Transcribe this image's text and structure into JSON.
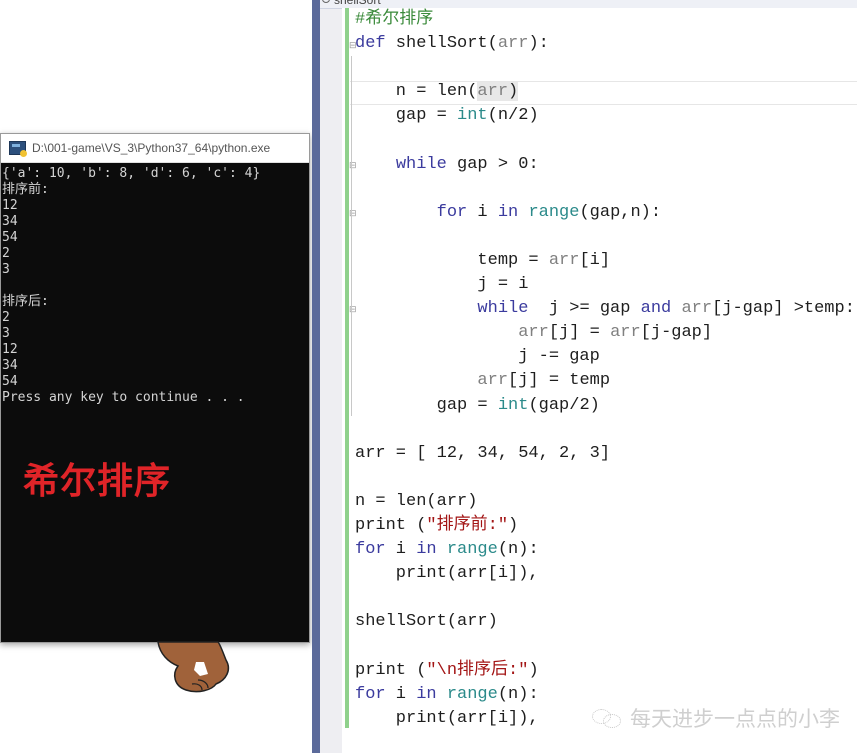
{
  "console": {
    "title": "D:\\001-game\\VS_3\\Python37_64\\python.exe",
    "lines": [
      "{'a': 10, 'b': 8, 'd': 6, 'c': 4}",
      "排序前:",
      "12",
      "34",
      "54",
      "2",
      "3",
      "",
      "排序后:",
      "2",
      "3",
      "12",
      "34",
      "54",
      "Press any key to continue . . ."
    ],
    "banner": "希尔排序"
  },
  "editor": {
    "tab_label": "shellSort",
    "lines": [
      [
        {
          "t": "#希尔排序",
          "c": "cm"
        }
      ],
      [
        {
          "t": "def",
          "c": "kw"
        },
        {
          "t": " shellSort("
        },
        {
          "t": "arr",
          "c": "nm"
        },
        {
          "t": "):"
        }
      ],
      [
        {
          "t": ""
        }
      ],
      [
        {
          "t": "    n = len("
        },
        {
          "t": "arr",
          "c": "nm hl"
        },
        {
          "t": ")",
          "c": "hl"
        }
      ],
      [
        {
          "t": "    gap = "
        },
        {
          "t": "int",
          "c": "bi"
        },
        {
          "t": "(n/2)"
        }
      ],
      [
        {
          "t": ""
        }
      ],
      [
        {
          "t": "    "
        },
        {
          "t": "while",
          "c": "kw"
        },
        {
          "t": " gap > 0:"
        }
      ],
      [
        {
          "t": ""
        }
      ],
      [
        {
          "t": "        "
        },
        {
          "t": "for",
          "c": "kw"
        },
        {
          "t": " i "
        },
        {
          "t": "in",
          "c": "kw"
        },
        {
          "t": " "
        },
        {
          "t": "range",
          "c": "bi"
        },
        {
          "t": "(gap,n):"
        }
      ],
      [
        {
          "t": ""
        }
      ],
      [
        {
          "t": "            temp = "
        },
        {
          "t": "arr",
          "c": "nm"
        },
        {
          "t": "[i]"
        }
      ],
      [
        {
          "t": "            j = i"
        }
      ],
      [
        {
          "t": "            "
        },
        {
          "t": "while",
          "c": "kw"
        },
        {
          "t": "  j >= gap "
        },
        {
          "t": "and",
          "c": "kw"
        },
        {
          "t": " "
        },
        {
          "t": "arr",
          "c": "nm"
        },
        {
          "t": "[j-gap] >temp:"
        }
      ],
      [
        {
          "t": "                "
        },
        {
          "t": "arr",
          "c": "nm"
        },
        {
          "t": "[j] = "
        },
        {
          "t": "arr",
          "c": "nm"
        },
        {
          "t": "[j-gap]"
        }
      ],
      [
        {
          "t": "                j -= gap"
        }
      ],
      [
        {
          "t": "            "
        },
        {
          "t": "arr",
          "c": "nm"
        },
        {
          "t": "[j] = temp"
        }
      ],
      [
        {
          "t": "        gap = "
        },
        {
          "t": "int",
          "c": "bi"
        },
        {
          "t": "(gap/2)"
        }
      ],
      [
        {
          "t": ""
        }
      ],
      [
        {
          "t": "arr = [ 12, 34, 54, 2, 3]"
        }
      ],
      [
        {
          "t": ""
        }
      ],
      [
        {
          "t": "n = len(arr)"
        }
      ],
      [
        {
          "t": "print ("
        },
        {
          "t": "\"排序前:\"",
          "c": "st"
        },
        {
          "t": ")"
        }
      ],
      [
        {
          "t": "for",
          "c": "kw"
        },
        {
          "t": " i "
        },
        {
          "t": "in",
          "c": "kw"
        },
        {
          "t": " "
        },
        {
          "t": "range",
          "c": "bi"
        },
        {
          "t": "(n):"
        }
      ],
      [
        {
          "t": "    print(arr[i]),"
        }
      ],
      [
        {
          "t": ""
        }
      ],
      [
        {
          "t": "shellSort(arr)"
        }
      ],
      [
        {
          "t": ""
        }
      ],
      [
        {
          "t": "print ("
        },
        {
          "t": "\"\\n排序后:\"",
          "c": "st"
        },
        {
          "t": ")"
        }
      ],
      [
        {
          "t": "for",
          "c": "kw"
        },
        {
          "t": " i "
        },
        {
          "t": "in",
          "c": "kw"
        },
        {
          "t": " "
        },
        {
          "t": "range",
          "c": "bi"
        },
        {
          "t": "(n):"
        }
      ],
      [
        {
          "t": "    print(arr[i]),"
        }
      ]
    ]
  },
  "watermark": {
    "text": "每天进步一点点的小李",
    "icon": "wechat-icon"
  },
  "colors": {
    "banner": "#e02428",
    "keyword": "#3b3b9e",
    "builtin": "#2b8a8a",
    "comment": "#3a8a3a",
    "string": "#a31515",
    "change_bar": "#8fd18c"
  }
}
